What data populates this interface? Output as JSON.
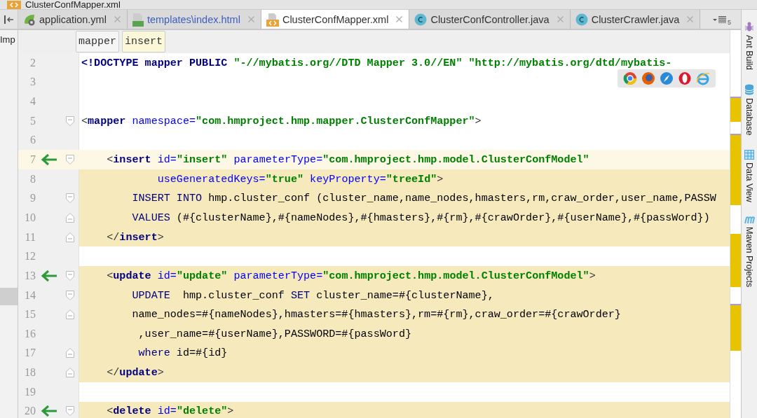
{
  "path_bar": {
    "file": "ClusterConfMapper.xml"
  },
  "tabs": [
    {
      "label": "application.yml",
      "kind": "spring",
      "selected": false,
      "modified": false
    },
    {
      "label": "templates\\index.html",
      "kind": "html",
      "selected": false,
      "modified": true
    },
    {
      "label": "ClusterConfMapper.xml",
      "kind": "xml",
      "selected": true,
      "modified": false
    },
    {
      "label": "ClusterConfController.java",
      "kind": "class",
      "selected": false,
      "modified": false
    },
    {
      "label": "ClusterCrawler.java",
      "kind": "class",
      "selected": false,
      "modified": false
    }
  ],
  "tab_overflow_count": "5",
  "left_panel": {
    "label": "Imp"
  },
  "breadcrumbs": [
    {
      "label": "mapper",
      "selected": false
    },
    {
      "label": "insert",
      "selected": true
    }
  ],
  "lines": [
    {
      "number": "2",
      "current": false,
      "highlighted": false,
      "arrow": false,
      "fold_start": false,
      "fold_end": false,
      "tokens": [
        {
          "kind": "tag",
          "t": "<!DOCTYPE mapper PUBLIC"
        },
        {
          "kind": "value",
          "t": " \"-//mybatis.org//DTD Mapper 3.0//EN\" \"http://mybatis.org/dtd/mybatis-"
        }
      ]
    },
    {
      "number": "3",
      "current": false,
      "highlighted": false,
      "arrow": false,
      "fold_start": false,
      "fold_end": false
    },
    {
      "number": "4",
      "current": false,
      "highlighted": false,
      "arrow": false,
      "fold_start": false,
      "fold_end": false
    },
    {
      "number": "5",
      "current": false,
      "highlighted": false,
      "arrow": false,
      "fold_start": true,
      "fold_end": false,
      "tokens": [
        {
          "kind": "punct",
          "t": "<"
        },
        {
          "kind": "tag",
          "t": "mapper"
        },
        {
          "kind": "attr",
          "t": " namespace="
        },
        {
          "kind": "value",
          "t": "\"com.hmproject.hmp.mapper.ClusterConfMapper\""
        },
        {
          "kind": "punct",
          "t": ">"
        }
      ]
    },
    {
      "number": "6",
      "current": false,
      "highlighted": false,
      "arrow": false,
      "fold_start": false,
      "fold_end": false
    },
    {
      "number": "7",
      "current": true,
      "highlighted": false,
      "arrow": true,
      "fold_start": true,
      "fold_end": false,
      "tokens": [
        {
          "kind": "punct",
          "t": "    <"
        },
        {
          "kind": "tag",
          "t": "insert"
        },
        {
          "kind": "attr",
          "t": " id="
        },
        {
          "kind": "value",
          "t": "\"insert\""
        },
        {
          "kind": "attr",
          "t": " parameterType="
        },
        {
          "kind": "value",
          "t": "\"com.hmproject.hmp.model.ClusterConfModel\""
        }
      ]
    },
    {
      "number": "8",
      "current": false,
      "highlighted": true,
      "arrow": false,
      "fold_start": false,
      "fold_end": false,
      "tokens": [
        {
          "kind": "attr",
          "t": "            useGeneratedKeys="
        },
        {
          "kind": "value",
          "t": "\"true\""
        },
        {
          "kind": "attr",
          "t": " keyProperty="
        },
        {
          "kind": "value",
          "t": "\"treeId\""
        },
        {
          "kind": "punct",
          "t": ">"
        }
      ]
    },
    {
      "number": "9",
      "current": false,
      "highlighted": true,
      "arrow": false,
      "fold_start": true,
      "fold_end": false,
      "tokens": [
        {
          "kind": "keyword",
          "t": "        INSERT INTO"
        },
        {
          "kind": "text",
          "t": " hmp.cluster_conf (cluster_name,name_nodes,hmasters,rm,craw_order,user_name,PASSW"
        }
      ]
    },
    {
      "number": "10",
      "current": false,
      "highlighted": true,
      "arrow": false,
      "fold_start": false,
      "fold_end": true,
      "tokens": [
        {
          "kind": "keyword",
          "t": "        VALUES"
        },
        {
          "kind": "text",
          "t": " (#{clusterName},#{nameNodes},#{hmasters},#{rm},#{crawOrder},#{userName},#{passWord})"
        }
      ]
    },
    {
      "number": "11",
      "current": false,
      "highlighted": true,
      "arrow": false,
      "fold_start": false,
      "fold_end": true,
      "tokens": [
        {
          "kind": "punct",
          "t": "    </"
        },
        {
          "kind": "tag",
          "t": "insert"
        },
        {
          "kind": "punct",
          "t": ">"
        }
      ]
    },
    {
      "number": "12",
      "current": false,
      "highlighted": false,
      "arrow": false,
      "fold_start": false,
      "fold_end": false
    },
    {
      "number": "13",
      "current": false,
      "highlighted": true,
      "arrow": true,
      "fold_start": true,
      "fold_end": false,
      "tokens": [
        {
          "kind": "punct",
          "t": "    <"
        },
        {
          "kind": "tag",
          "t": "update"
        },
        {
          "kind": "attr",
          "t": " id="
        },
        {
          "kind": "value",
          "t": "\"update\""
        },
        {
          "kind": "attr",
          "t": " parameterType="
        },
        {
          "kind": "value",
          "t": "\"com.hmproject.hmp.model.ClusterConfModel\""
        },
        {
          "kind": "punct",
          "t": ">"
        }
      ]
    },
    {
      "number": "14",
      "current": false,
      "highlighted": true,
      "arrow": false,
      "fold_start": true,
      "fold_end": false,
      "tokens": [
        {
          "kind": "keyword",
          "t": "        UPDATE"
        },
        {
          "kind": "text",
          "t": "  hmp.cluster_conf "
        },
        {
          "kind": "keyword",
          "t": "SET"
        },
        {
          "kind": "text",
          "t": " cluster_name=#{clusterName},"
        }
      ]
    },
    {
      "number": "15",
      "current": false,
      "highlighted": true,
      "arrow": false,
      "fold_start": false,
      "fold_end": true,
      "tokens": [
        {
          "kind": "text",
          "t": "        name_nodes=#{nameNodes},hmasters=#{hmasters},rm=#{rm},craw_order=#{crawOrder}"
        }
      ]
    },
    {
      "number": "16",
      "current": false,
      "highlighted": true,
      "arrow": false,
      "fold_start": false,
      "fold_end": false,
      "tokens": [
        {
          "kind": "text",
          "t": "         ,user_name=#{userName},PASSWORD=#{passWord}"
        }
      ]
    },
    {
      "number": "17",
      "current": false,
      "highlighted": true,
      "arrow": false,
      "fold_start": false,
      "fold_end": true,
      "tokens": [
        {
          "kind": "keyword",
          "t": "         where"
        },
        {
          "kind": "text",
          "t": " id=#{id}"
        }
      ]
    },
    {
      "number": "18",
      "current": false,
      "highlighted": true,
      "arrow": false,
      "fold_start": false,
      "fold_end": true,
      "tokens": [
        {
          "kind": "punct",
          "t": "    </"
        },
        {
          "kind": "tag",
          "t": "update"
        },
        {
          "kind": "punct",
          "t": ">"
        }
      ]
    },
    {
      "number": "19",
      "current": false,
      "highlighted": false,
      "arrow": false,
      "fold_start": false,
      "fold_end": false
    },
    {
      "number": "20",
      "current": false,
      "highlighted": true,
      "arrow": true,
      "fold_start": true,
      "fold_end": false,
      "tokens": [
        {
          "kind": "punct",
          "t": "    <"
        },
        {
          "kind": "tag",
          "t": "delete"
        },
        {
          "kind": "attr",
          "t": " id="
        },
        {
          "kind": "value",
          "t": "\"delete\""
        },
        {
          "kind": "punct",
          "t": ">"
        }
      ]
    }
  ],
  "tool_windows": [
    {
      "label": "Ant Build",
      "kind": "ant"
    },
    {
      "label": "Database",
      "kind": "database"
    },
    {
      "label": "Data View",
      "kind": "grid"
    },
    {
      "label": "Maven Projects",
      "kind": "maven"
    }
  ]
}
